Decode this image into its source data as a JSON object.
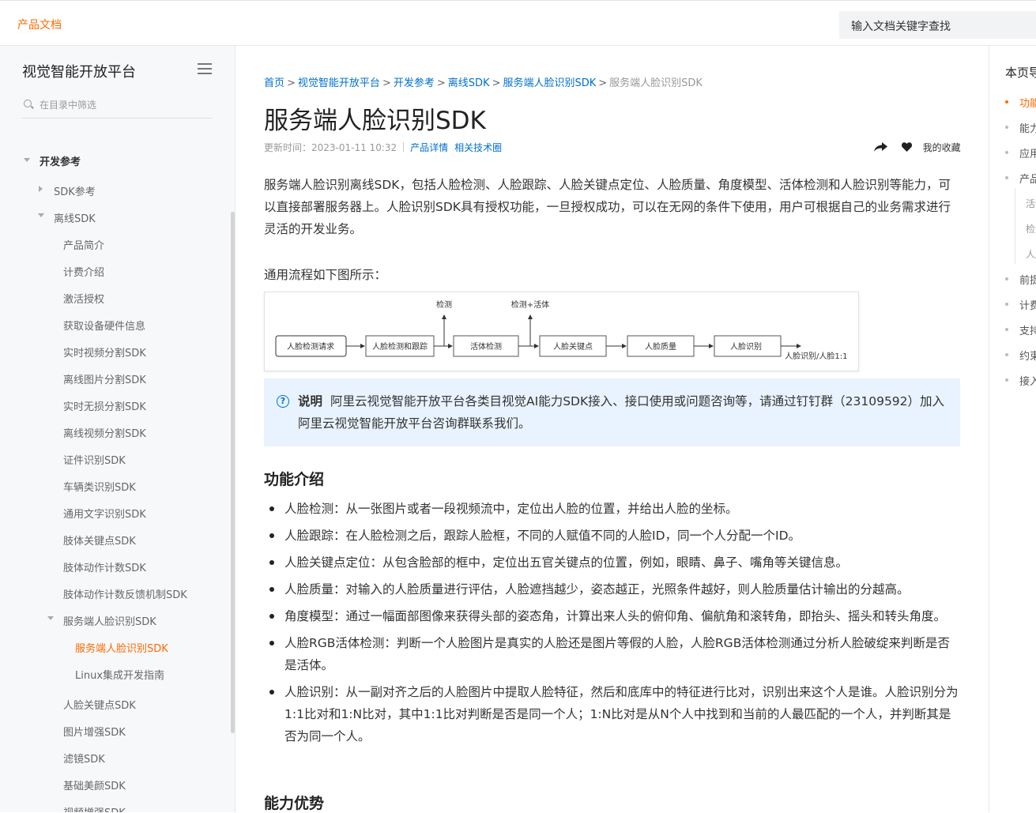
{
  "topbar": {
    "brand": "产品文档",
    "search_placeholder": "输入文档关键字查找"
  },
  "sidebar": {
    "title": "视觉智能开放平台",
    "filter_placeholder": "在目录中筛选",
    "section": "开发参考",
    "items": [
      "SDK参考",
      "离线SDK",
      "产品简介",
      "计费介绍",
      "激活授权",
      "获取设备硬件信息",
      "实时视频分割SDK",
      "离线图片分割SDK",
      "实时无损分割SDK",
      "离线视频分割SDK",
      "证件识别SDK",
      "车辆类识别SDK",
      "通用文字识别SDK",
      "肢体关键点SDK",
      "肢体动作计数SDK",
      "肢体动作计数反馈机制SDK",
      "服务端人脸识别SDK",
      "服务端人脸识别SDK",
      "Linux集成开发指南",
      "人脸关键点SDK",
      "图片增强SDK",
      "滤镜SDK",
      "基础美颜SDK",
      "视频增强SDK"
    ]
  },
  "breadcrumb": [
    "首页",
    "视觉智能开放平台",
    "开发参考",
    "离线SDK",
    "服务端人脸识别SDK",
    "服务端人脸识别SDK"
  ],
  "page": {
    "title": "服务端人脸识别SDK",
    "updated": "更新时间：2023-01-11 10:32",
    "link_detail": "产品详情",
    "link_circle": "相关技术圈",
    "favorite": "我的收藏",
    "intro": "服务端人脸识别离线SDK，包括人脸检测、人脸跟踪、人脸关键点定位、人脸质量、角度模型、活体检测和人脸识别等能力，可以直接部署服务器上。人脸识别SDK具有授权功能，一旦授权成功，可以在无网的条件下使用，用户可根据自己的业务需求进行灵活的开发业务。",
    "flow_label": "通用流程如下图所示：",
    "flow": {
      "nodes": [
        "人脸检测请求",
        "人脸检测和跟踪",
        "活体检测",
        "人脸关键点",
        "人脸质量",
        "人脸识别"
      ],
      "top_labels": [
        "检测",
        "检测+活体"
      ],
      "end_label": "人脸识别/人脸1:1"
    },
    "note_label": "说明",
    "note_text": "阿里云视觉智能开放平台各类目视觉AI能力SDK接入、接口使用或问题咨询等，请通过钉钉群（23109592）加入阿里云视觉智能开放平台咨询群联系我们。",
    "h_features": "功能介绍",
    "features": [
      "人脸检测：从一张图片或者一段视频流中，定位出人脸的位置，并给出人脸的坐标。",
      "人脸跟踪：在人脸检测之后，跟踪人脸框，不同的人赋值不同的人脸ID，同一个人分配一个ID。",
      "人脸关键点定位：从包含脸部的框中，定位出五官关键点的位置，例如，眼睛、鼻子、嘴角等关键信息。",
      "人脸质量：对输入的人脸质量进行评估，人脸遮挡越少，姿态越正，光照条件越好，则人脸质量估计输出的分越高。",
      "角度模型：通过一幅面部图像来获得头部的姿态角，计算出来人头的俯仰角、偏航角和滚转角，即抬头、摇头和转头角度。",
      "人脸RGB活体检测：判断一个人脸图片是真实的人脸还是图片等假的人脸，人脸RGB活体检测通过分析人脸破绽来判断是否是活体。",
      "人脸识别：从一副对齐之后的人脸图片中提取人脸特征，然后和底库中的特征进行比对，识别出来这个人是谁。人脸识别分为1:1比对和1:N比对，其中1:1比对判断是否是同一个人；1:N比对是从N个人中找到和当前的人最匹配的一个人，并判断其是否为同一个人。"
    ],
    "h_advantages": "能力优势"
  },
  "toc": {
    "title": "本页导读",
    "items": [
      "功能",
      "能力",
      "应用",
      "产品",
      "前提",
      "计费",
      "支持",
      "约束",
      "接入"
    ],
    "subitems": [
      "活体",
      "检测",
      "人脸"
    ]
  }
}
